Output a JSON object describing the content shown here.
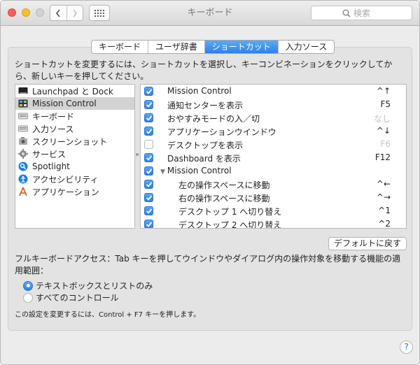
{
  "window": {
    "title": "キーボード",
    "search_placeholder": "検索"
  },
  "tabs": [
    {
      "label": "キーボード"
    },
    {
      "label": "ユーザ辞書"
    },
    {
      "label": "ショートカット"
    },
    {
      "label": "入力ソース"
    }
  ],
  "active_tab": "ショートカット",
  "description": "ショートカットを変更するには、ショートカットを選択し、キーコンビネーションをクリックしてから、新しいキーを押してください。",
  "categories": [
    {
      "label": "Launchpad と Dock",
      "icon": "launchpad-icon"
    },
    {
      "label": "Mission Control",
      "icon": "mission-control-icon"
    },
    {
      "label": "キーボード",
      "icon": "keyboard-icon"
    },
    {
      "label": "入力ソース",
      "icon": "input-source-icon"
    },
    {
      "label": "スクリーンショット",
      "icon": "screenshot-icon"
    },
    {
      "label": "サービス",
      "icon": "services-icon"
    },
    {
      "label": "Spotlight",
      "icon": "spotlight-icon"
    },
    {
      "label": "アクセシビリティ",
      "icon": "accessibility-icon"
    },
    {
      "label": "アプリケーション",
      "icon": "applications-icon"
    }
  ],
  "selected_category": "Mission Control",
  "shortcuts": [
    {
      "name": "Mission Control",
      "key": "^↑",
      "checked": true,
      "indent": 0,
      "dim": false
    },
    {
      "name": "通知センターを表示",
      "key": "F5",
      "checked": true,
      "indent": 0,
      "dim": false
    },
    {
      "name": "おやすみモードの入／切",
      "key": "なし",
      "checked": true,
      "indent": 0,
      "dim": true
    },
    {
      "name": "アプリケーションウインドウ",
      "key": "^↓",
      "checked": true,
      "indent": 0,
      "dim": false
    },
    {
      "name": "デスクトップを表示",
      "key": "F6",
      "checked": false,
      "indent": 0,
      "dim": true
    },
    {
      "name": "Dashboard を表示",
      "key": "F12",
      "checked": true,
      "indent": 0,
      "dim": false
    },
    {
      "name": "Mission Control",
      "key": "",
      "checked": true,
      "indent": 0,
      "dim": false,
      "group": true
    },
    {
      "name": "左の操作スペースに移動",
      "key": "^←",
      "checked": true,
      "indent": 1,
      "dim": false
    },
    {
      "name": "右の操作スペースに移動",
      "key": "^→",
      "checked": true,
      "indent": 1,
      "dim": false
    },
    {
      "name": "デスクトップ 1 へ切り替え",
      "key": "^1",
      "checked": true,
      "indent": 1,
      "dim": false
    },
    {
      "name": "デスクトップ 2 へ切り替え",
      "key": "^2",
      "checked": true,
      "indent": 1,
      "dim": false
    }
  ],
  "default_button": "デフォルトに戻す",
  "full_keyboard_access": "フルキーボードアクセス：Tab キーを押してウインドウやダイアログ内の操作対象を移動する機能の適用範囲：",
  "radio_options": [
    {
      "label": "テキストボックスとリストのみ",
      "selected": true
    },
    {
      "label": "すべてのコントロール",
      "selected": false
    }
  ],
  "note": "この設定を変更するには、Control + F7 キーを押します。",
  "help_label": "?",
  "colors": {
    "accent": "#2f80ec",
    "window_bg": "#ececec",
    "panel_bg": "#e3e3e3"
  }
}
